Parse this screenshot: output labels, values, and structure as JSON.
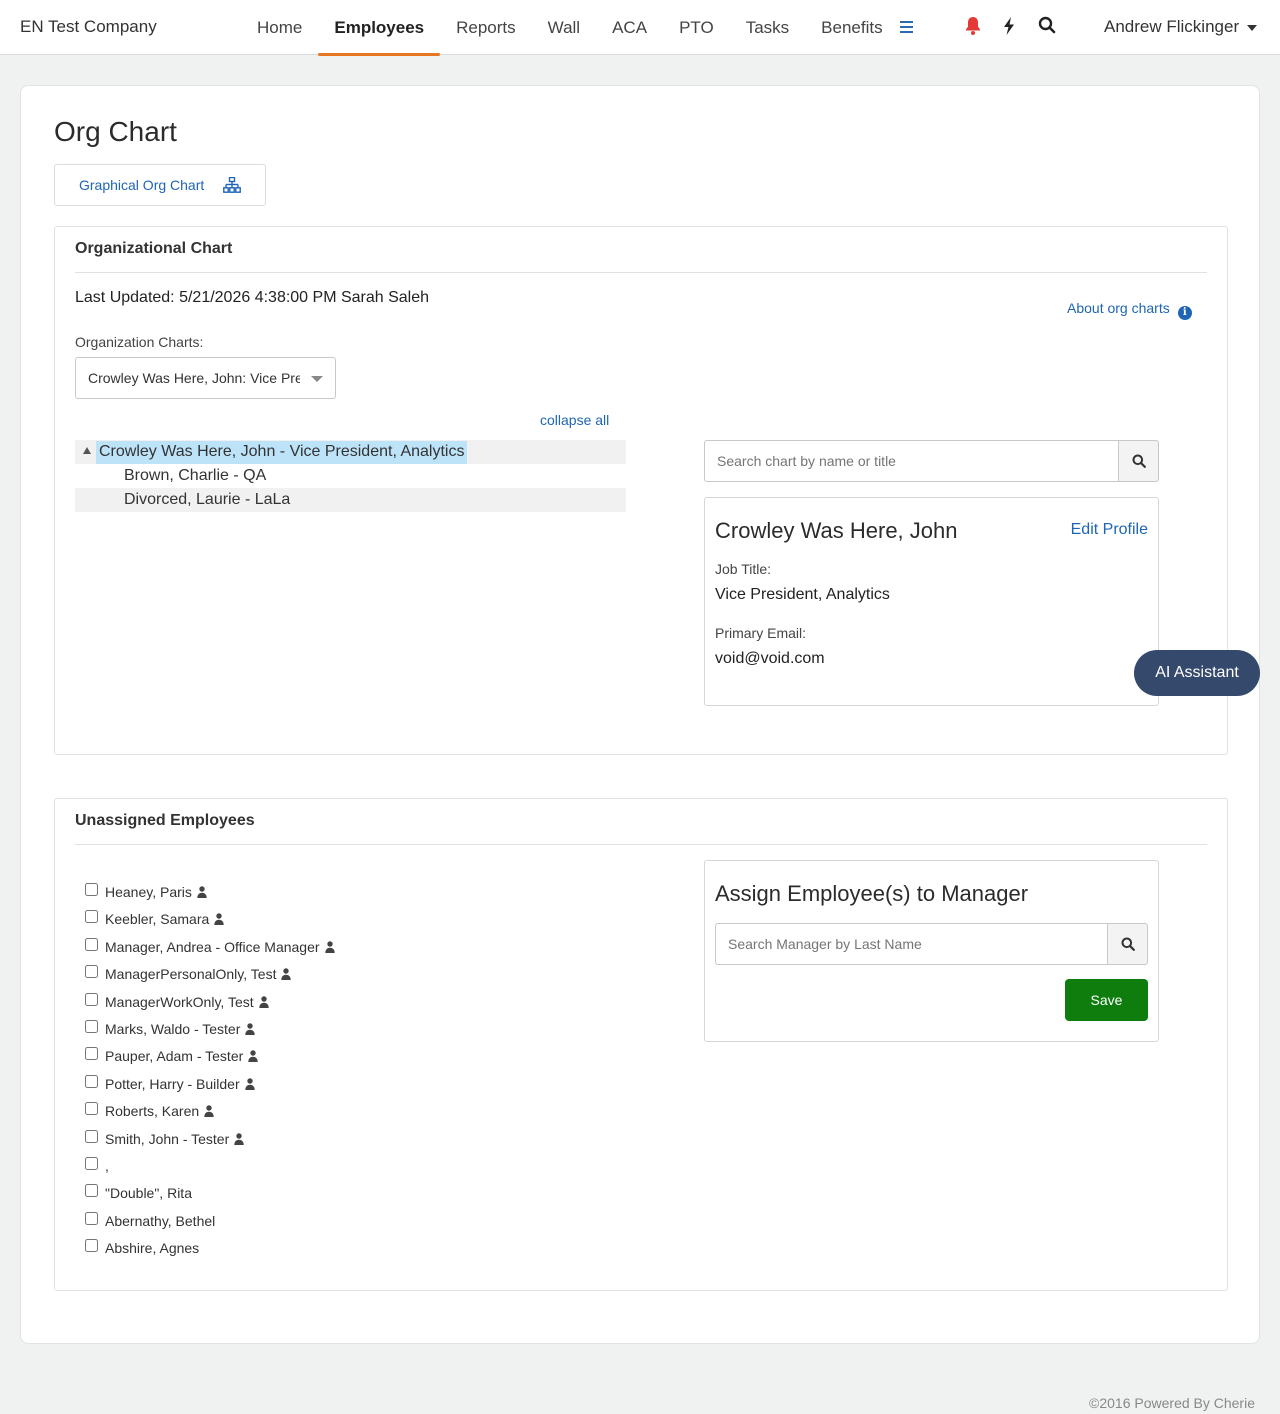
{
  "header": {
    "brand": "EN Test Company",
    "nav": [
      "Home",
      "Employees",
      "Reports",
      "Wall",
      "ACA",
      "PTO",
      "Tasks",
      "Benefits"
    ],
    "active_nav": "Employees",
    "user_name": "Andrew Flickinger",
    "icons": [
      "menu-icon",
      "bell-icon",
      "lightning-icon",
      "search-icon"
    ],
    "colors": {
      "accent_underline": "#e87722",
      "bell": "#e53935",
      "link": "#1f65b5"
    }
  },
  "page": {
    "title": "Org Chart",
    "graphical_button": "Graphical Org Chart"
  },
  "org_panel": {
    "heading": "Organizational Chart",
    "last_updated": "Last Updated: 5/21/2026 4:38:00 PM Sarah Saleh",
    "about_link": "About org charts",
    "charts_label": "Organization Charts:",
    "selected_chart": "Crowley Was Here, John: Vice President, Analytics",
    "collapse_all": "collapse all",
    "tree": [
      {
        "label": "Crowley Was Here, John - Vice President, Analytics",
        "selected": true,
        "expanded": true
      },
      {
        "label": "Brown, Charlie - QA"
      },
      {
        "label": "Divorced, Laurie - LaLa"
      }
    ],
    "search_placeholder": "Search chart by name or title",
    "profile": {
      "name": "Crowley Was Here, John",
      "edit_link": "Edit Profile",
      "job_title_label": "Job Title:",
      "job_title": "Vice President, Analytics",
      "email_label": "Primary Email:",
      "email": "void@void.com"
    }
  },
  "ai_assistant": "AI Assistant",
  "unassigned": {
    "heading": "Unassigned Employees",
    "employees": [
      {
        "name": "Heaney, Paris",
        "person": true
      },
      {
        "name": "Keebler, Samara",
        "person": true
      },
      {
        "name": "Manager, Andrea - Office Manager",
        "person": true
      },
      {
        "name": "ManagerPersonalOnly, Test",
        "person": true
      },
      {
        "name": "ManagerWorkOnly, Test",
        "person": true
      },
      {
        "name": "Marks, Waldo - Tester",
        "person": true
      },
      {
        "name": "Pauper, Adam - Tester",
        "person": true
      },
      {
        "name": "Potter, Harry - Builder",
        "person": true
      },
      {
        "name": "Roberts, Karen",
        "person": true
      },
      {
        "name": "Smith, John - Tester",
        "person": true
      },
      {
        "name": ",",
        "person": false
      },
      {
        "name": "\"Double\", Rita",
        "person": false
      },
      {
        "name": "Abernathy, Bethel",
        "person": false
      },
      {
        "name": "Abshire, Agnes",
        "person": false
      }
    ],
    "assign_title": "Assign Employee(s) to Manager",
    "manager_search_placeholder": "Search Manager by Last Name",
    "save_label": "Save"
  },
  "footer": "©2016 Powered By Cherie"
}
